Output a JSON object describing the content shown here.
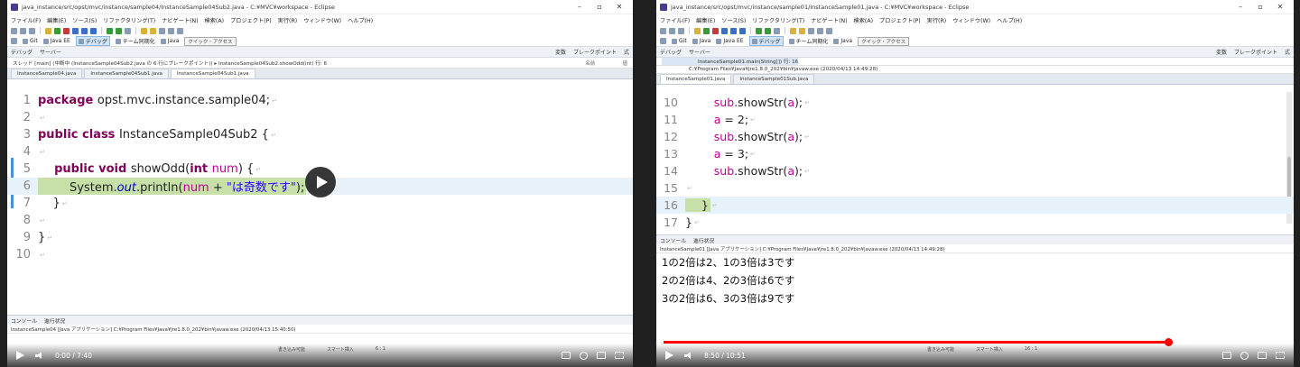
{
  "video_a": {
    "window_title": "java_instance/src/opst/mvc/instance/sample04/InstanceSample04Sub2.java - C:¥MVC¥workspace - Eclipse",
    "menu": [
      "ファイル(F)",
      "編集(E)",
      "ソース(S)",
      "リファクタリング(T)",
      "ナビゲート(N)",
      "検索(A)",
      "プロジェクト(P)",
      "実行(R)",
      "ウィンドウ(W)",
      "ヘルプ(H)"
    ],
    "perspectives": [
      "Git",
      "Java EE",
      "デバッグ",
      "チーム同期化",
      "Java"
    ],
    "quick_access": "クイック・アクセス",
    "views": [
      "デバッグ",
      "サーバー"
    ],
    "views_right": [
      "変数",
      "ブレークポイント",
      "式"
    ],
    "stack_frame": "スレッド [main] (中断中 (InstanceSample04Sub2.java の 6 行にブレークポイント)) ▸ InstanceSample04Sub2.showOdd(int) 行: 6",
    "var_headers": [
      "名前",
      "値"
    ],
    "tabs": [
      "InstanceSample04.java",
      "InstanceSample04Sub1.java",
      "InstanceSample04Sub1.java"
    ],
    "code": [
      {
        "n": "1",
        "tokens": [
          {
            "t": "package ",
            "c": "kw"
          },
          {
            "t": "opst.mvc.instance.sample04;",
            "c": "plain"
          }
        ]
      },
      {
        "n": "2",
        "tokens": []
      },
      {
        "n": "3",
        "tokens": [
          {
            "t": "public class ",
            "c": "kw"
          },
          {
            "t": "InstanceSample04Sub2 {",
            "c": "plain"
          }
        ]
      },
      {
        "n": "4",
        "tokens": []
      },
      {
        "n": "5",
        "tokens": [
          {
            "t": "    public void ",
            "c": "kw"
          },
          {
            "t": "showOdd(",
            "c": "plain"
          },
          {
            "t": "int ",
            "c": "kw"
          },
          {
            "t": "num",
            "c": "var"
          },
          {
            "t": ") {",
            "c": "plain"
          }
        ]
      },
      {
        "n": "6",
        "tokens": [
          {
            "t": "        System.",
            "c": "plain"
          },
          {
            "t": "out",
            "c": "fld"
          },
          {
            "t": ".println(",
            "c": "plain"
          },
          {
            "t": "num",
            "c": "var"
          },
          {
            "t": " + ",
            "c": "plain"
          },
          {
            "t": "\"は奇数です\"",
            "c": "str"
          },
          {
            "t": ");",
            "c": "plain"
          }
        ]
      },
      {
        "n": "7",
        "tokens": [
          {
            "t": "    }",
            "c": "plain"
          }
        ]
      },
      {
        "n": "8",
        "tokens": []
      },
      {
        "n": "9",
        "tokens": [
          {
            "t": "}",
            "c": "plain"
          }
        ]
      },
      {
        "n": "10",
        "tokens": []
      }
    ],
    "console_tabs": [
      "コンソール",
      "進行状況"
    ],
    "console_head": "InstanceSample04 [Java アプリケーション] C:¥Program Files¥Java¥jre1.8.0_202¥bin¥javaw.exe (2020/04/13 15:40:50)",
    "status": [
      "書き込み可能",
      "スマート挿入",
      "6 : 1"
    ],
    "time": "0:00 / 7:40",
    "progress": 0
  },
  "video_b": {
    "window_title": "java_instance/src/opst/mvc/instance/sample01/InstanceSample01.java - C:¥MVC¥workspace - Eclipse",
    "menu": [
      "ファイル(F)",
      "編集(E)",
      "ソース(S)",
      "リファクタリング(T)",
      "ナビゲート(N)",
      "検索(A)",
      "プロジェクト(P)",
      "実行(R)",
      "ウィンドウ(W)",
      "ヘルプ(H)"
    ],
    "perspectives": [
      "Git",
      "Java",
      "Java EE",
      "デバッグ",
      "チーム同期化",
      "Java"
    ],
    "quick_access": "クイック・アクセス",
    "views": [
      "デバッグ",
      "サーバー"
    ],
    "views_right": [
      "変数",
      "ブレークポイント",
      "式"
    ],
    "stack_frame": "InstanceSample01.main(String[]) 行: 16",
    "stack_frame2": "C:¥Program Files¥Java¥jre1.8.0_202¥bin¥javaw.exe (2020/04/13 14:49:28)",
    "tabs": [
      "InstanceSample01.java",
      "InstanceSample01Sub.java"
    ],
    "code": [
      {
        "n": "10",
        "tokens": [
          {
            "t": "        sub",
            "c": "var"
          },
          {
            "t": ".showStr(",
            "c": "plain"
          },
          {
            "t": "a",
            "c": "var"
          },
          {
            "t": ");",
            "c": "plain"
          }
        ]
      },
      {
        "n": "11",
        "tokens": [
          {
            "t": "        a",
            "c": "var"
          },
          {
            "t": " = 2;",
            "c": "plain"
          }
        ]
      },
      {
        "n": "12",
        "tokens": [
          {
            "t": "        sub",
            "c": "var"
          },
          {
            "t": ".showStr(",
            "c": "plain"
          },
          {
            "t": "a",
            "c": "var"
          },
          {
            "t": ");",
            "c": "plain"
          }
        ]
      },
      {
        "n": "13",
        "tokens": [
          {
            "t": "        a",
            "c": "var"
          },
          {
            "t": " = 3;",
            "c": "plain"
          }
        ]
      },
      {
        "n": "14",
        "tokens": [
          {
            "t": "        sub",
            "c": "var"
          },
          {
            "t": ".showStr(",
            "c": "plain"
          },
          {
            "t": "a",
            "c": "var"
          },
          {
            "t": ");",
            "c": "plain"
          }
        ]
      },
      {
        "n": "15",
        "tokens": []
      },
      {
        "n": "16",
        "tokens": [
          {
            "t": "    }",
            "c": "plain"
          }
        ]
      },
      {
        "n": "17",
        "tokens": [
          {
            "t": "}",
            "c": "plain"
          }
        ]
      }
    ],
    "console_tabs": [
      "コンソール",
      "進行状況"
    ],
    "console_head": "InstanceSample01 [Java アプリケーション] C:¥Program Files¥Java¥jre1.8.0_202¥bin¥javaw.exe (2020/04/13 14:49:28)",
    "console_output": [
      "1の2倍は2、1の3倍は3です",
      "2の2倍は4、2の3倍は6です",
      "3の2倍は6、3の3倍は9です"
    ],
    "status": [
      "書き込み可能",
      "スマート挿入",
      "16 : 1"
    ],
    "time": "8:50 / 10:51",
    "progress": 0.81
  },
  "colors": {
    "highlight_line": "#c6e0a8",
    "progress_red": "#ff0000",
    "keyword": "#7f0055",
    "variable": "#c00090"
  }
}
